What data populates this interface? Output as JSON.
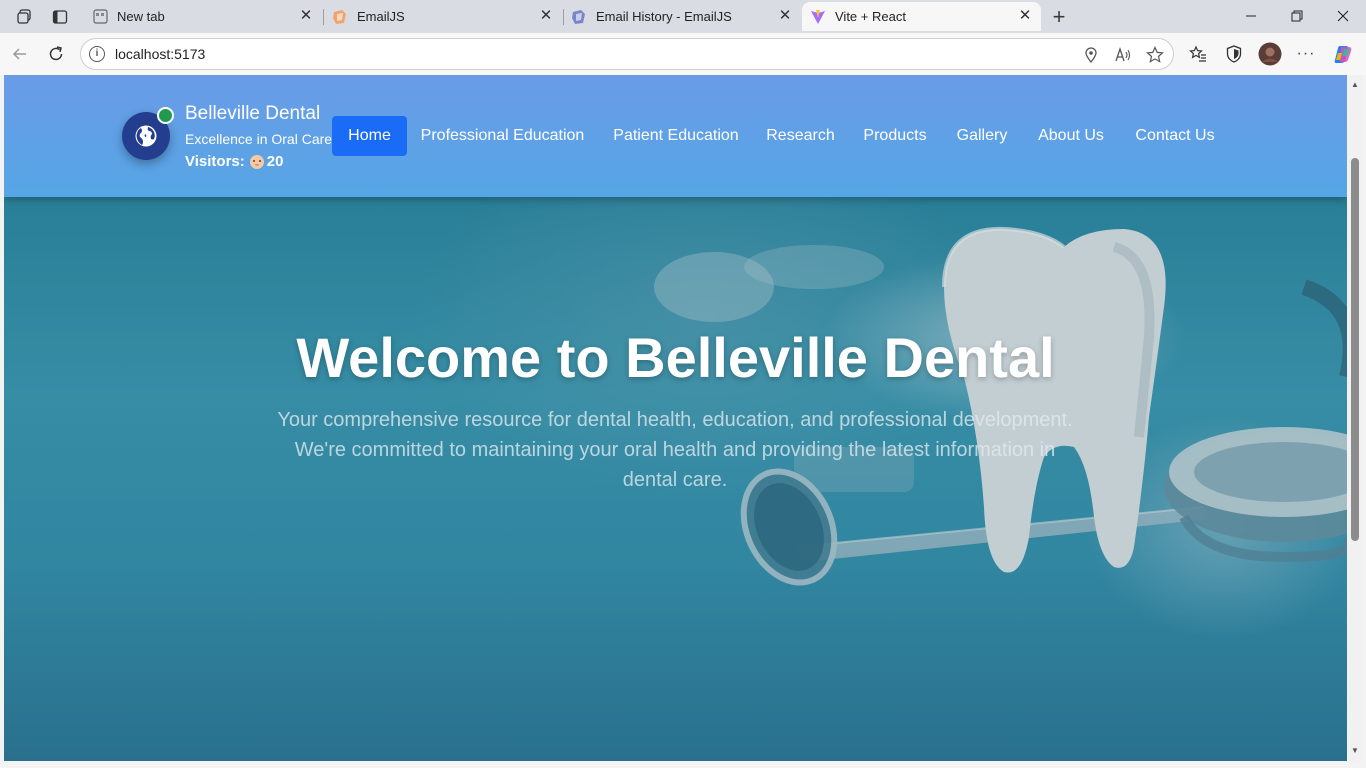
{
  "browser": {
    "tabs": [
      {
        "title": "New tab",
        "icon": "new-tab-page-icon"
      },
      {
        "title": "EmailJS",
        "icon": "emailjs-favicon"
      },
      {
        "title": "Email History - EmailJS",
        "icon": "emailjs-favicon"
      },
      {
        "title": "Vite + React",
        "icon": "vite-favicon",
        "active": true
      }
    ],
    "url": "localhost:5173"
  },
  "site": {
    "brand_name": "Belleville Dental",
    "tagline": "Excellence in Oral Care",
    "visitors_label": "Visitors:",
    "visitors_count": "20",
    "nav": [
      {
        "label": "Home",
        "active": true
      },
      {
        "label": "Professional Education"
      },
      {
        "label": "Patient Education"
      },
      {
        "label": "Research"
      },
      {
        "label": "Products"
      },
      {
        "label": "Gallery"
      },
      {
        "label": "About Us"
      },
      {
        "label": "Contact Us"
      }
    ]
  },
  "hero": {
    "title": "Welcome to Belleville Dental",
    "subtitle": "Your comprehensive resource for dental health, education, and professional development. We're committed to maintaining your oral health and providing the latest information in dental care."
  },
  "colors": {
    "header": "#5f9fe6",
    "nav_active": "#1a6cf7",
    "logo_bg": "#233d8f",
    "online_dot": "#1f9a4e",
    "hero": "#3796b3"
  }
}
